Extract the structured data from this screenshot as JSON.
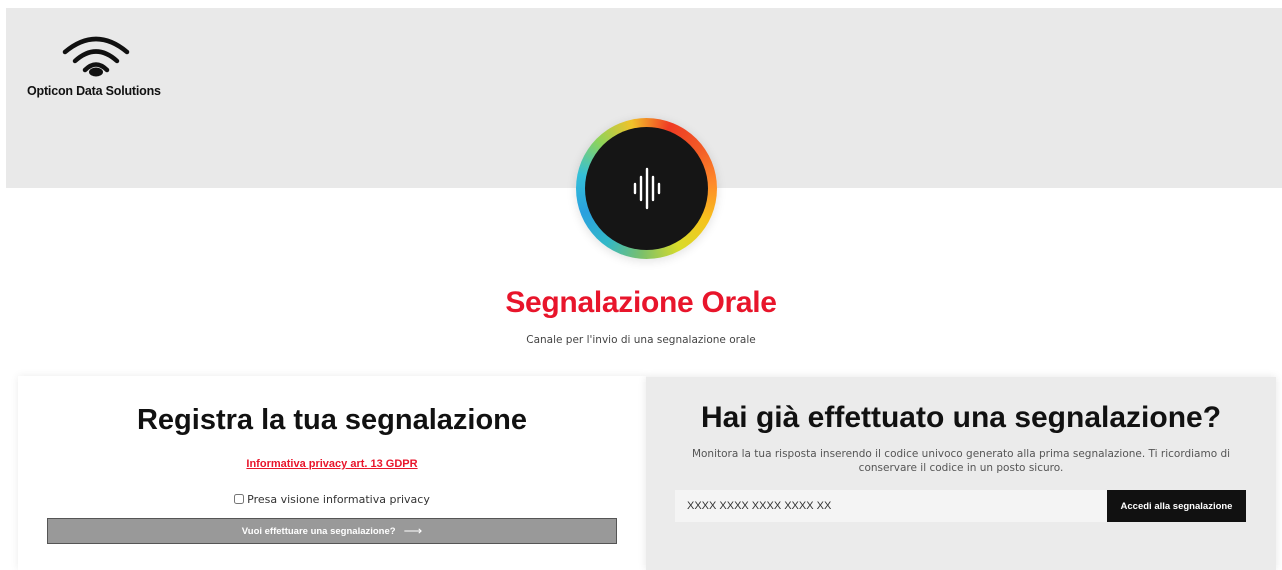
{
  "header": {
    "brand_name": "Opticon Data Solutions",
    "logo_icon": "wifi-signal-icon",
    "avatar_icon": "voice-waveform-icon",
    "background_color": "#e9e9e9"
  },
  "main": {
    "title": "Segnalazione Orale",
    "subtitle": "Canale per l'invio di una segnalazione orale",
    "title_color": "#e8152b"
  },
  "register_card": {
    "heading": "Registra la tua segnalazione",
    "privacy_link": "Informativa privacy art. 13 GDPR",
    "consent_label": "Presa visione informativa privacy",
    "consent_checked": false,
    "button_label": "Vuoi effettuare una segnalazione?",
    "button_icon": "arrow-right-icon",
    "button_arrow": "⟶"
  },
  "monitor_card": {
    "heading": "Hai già effettuato una segnalazione?",
    "description": "Monitora la tua risposta inserendo il codice univoco generato alla prima segnalazione. Ti ricordiamo di conservare il codice in un posto sicuro.",
    "code_placeholder": "XXXX XXXX XXXX XXXX XX",
    "code_value": "",
    "button_label": "Accedi alla segnalazione"
  }
}
